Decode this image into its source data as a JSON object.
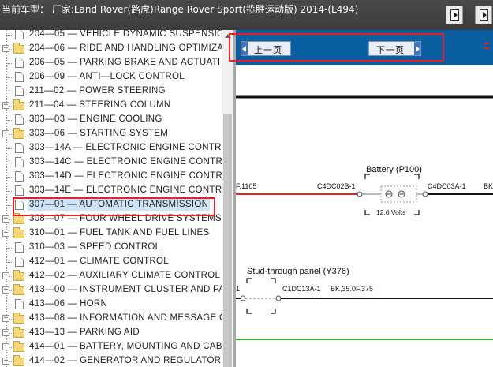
{
  "window": {
    "title": "当前车型： 厂家:Land Rover(路虎)Range Rover Sport(揽胜运动版) 2014-(L494)"
  },
  "tree": {
    "items": [
      {
        "label": "204—05 — VEHICLE DYNAMIC SUSPENSIO",
        "type": "doc",
        "expander": ""
      },
      {
        "label": "204—06 — RIDE AND HANDLING OPTIMIZA",
        "type": "folder",
        "expander": "+"
      },
      {
        "label": "206—05 — PARKING BRAKE AND ACTUATI",
        "type": "doc",
        "expander": ""
      },
      {
        "label": "206—09 — ANTI—LOCK CONTROL",
        "type": "doc",
        "expander": ""
      },
      {
        "label": "211—02 — POWER STEERING",
        "type": "doc",
        "expander": ""
      },
      {
        "label": "211—04 — STEERING COLUMN",
        "type": "folder",
        "expander": "+"
      },
      {
        "label": "303—03 — ENGINE COOLING",
        "type": "doc",
        "expander": ""
      },
      {
        "label": "303—06 — STARTING SYSTEM",
        "type": "folder",
        "expander": "+"
      },
      {
        "label": "303—14A — ELECTRONIC ENGINE CONTRO",
        "type": "doc",
        "expander": ""
      },
      {
        "label": "303—14C — ELECTRONIC ENGINE CONTRO",
        "type": "doc",
        "expander": ""
      },
      {
        "label": "303—14D — ELECTRONIC ENGINE CONTRO",
        "type": "doc",
        "expander": ""
      },
      {
        "label": "303—14E — ELECTRONIC ENGINE CONTRO",
        "type": "doc",
        "expander": ""
      },
      {
        "label": "307—01 — AUTOMATIC TRANSMISSION",
        "type": "doc",
        "expander": "",
        "selected": true
      },
      {
        "label": "308—07 — FOUR WHEEL DRIVE SYSTEMS",
        "type": "folder",
        "expander": "+"
      },
      {
        "label": "310—01 — FUEL TANK AND FUEL LINES",
        "type": "folder",
        "expander": "+"
      },
      {
        "label": "310—03 — SPEED CONTROL",
        "type": "doc",
        "expander": ""
      },
      {
        "label": "412—01 — CLIMATE CONTROL",
        "type": "doc",
        "expander": ""
      },
      {
        "label": "412—02 — AUXILIARY CLIMATE CONTROL",
        "type": "folder",
        "expander": "+"
      },
      {
        "label": "413—00 — INSTRUMENT CLUSTER AND PA",
        "type": "folder",
        "expander": "+"
      },
      {
        "label": "413—06 — HORN",
        "type": "doc",
        "expander": ""
      },
      {
        "label": "413—08 — INFORMATION AND MESSAGE C",
        "type": "folder",
        "expander": "+"
      },
      {
        "label": "413—13 — PARKING AID",
        "type": "folder",
        "expander": "+"
      },
      {
        "label": "414—01 — BATTERY, MOUNTING AND CAB",
        "type": "folder",
        "expander": "+"
      },
      {
        "label": "414—02 — GENERATOR AND REGULATOR",
        "type": "folder",
        "expander": "+"
      }
    ]
  },
  "nav": {
    "prev_label": "上一页",
    "next_label": "下一页"
  },
  "diagram": {
    "wire_left_label": "F,1105",
    "conn_left_battery": "C4DC02B-1",
    "battery_title": "Battery (P100)",
    "battery_voltage": "12.0 Volts",
    "conn_right_battery": "C4DC03A-1",
    "wire_right_label": "BK",
    "stud_title": "Stud-through panel (Y376)",
    "stud_left_num": "1",
    "stud_conn": "C1DC13A-1",
    "stud_wire": "BK,35.0F,375",
    "colors": {
      "red_wire": "#e8202a",
      "black_wire": "#111111",
      "green_wire": "#2db52d",
      "highlight": "#e8202a",
      "nav_blue": "#0a5fa0"
    }
  }
}
